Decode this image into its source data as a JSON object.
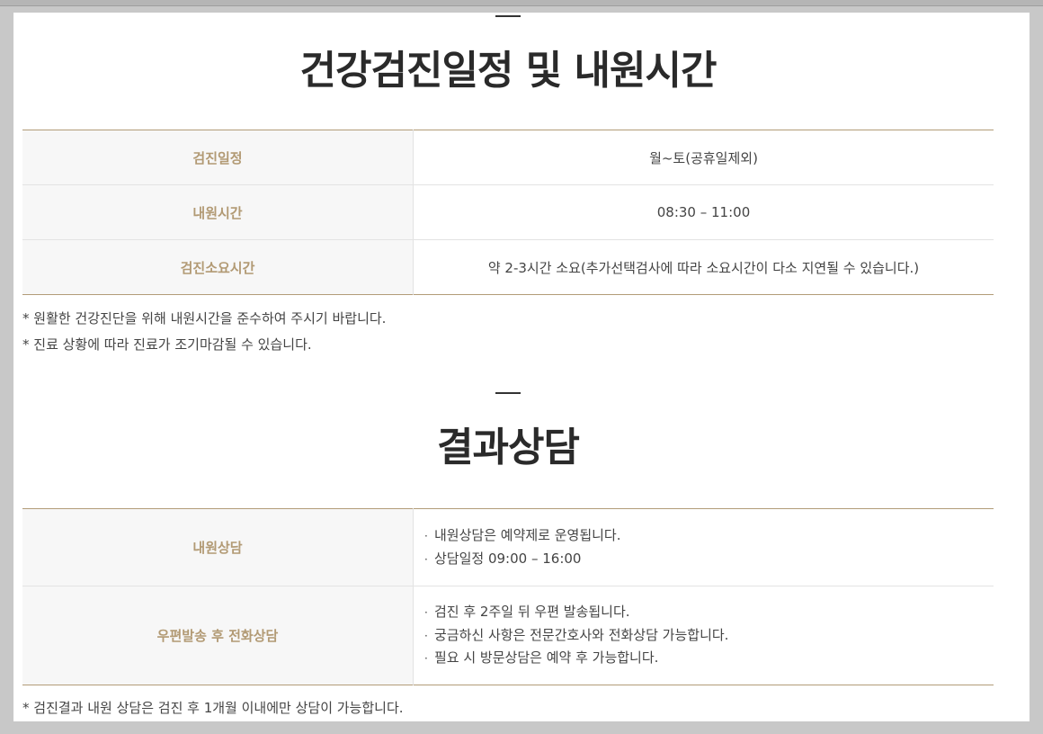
{
  "schedule": {
    "title": "건강검진일정 및 내원시간",
    "rows": [
      {
        "label": "검진일정",
        "value": "월~토(공휴일제외)"
      },
      {
        "label": "내원시간",
        "value": "08:30 – 11:00"
      },
      {
        "label": "검진소요시간",
        "value": "약 2-3시간 소요(추가선택검사에 따라 소요시간이 다소 지연될 수 있습니다.)"
      }
    ],
    "notes": [
      "* 원활한 건강진단을 위해 내원시간을 준수하여 주시기 바랍니다.",
      "* 진료 상황에 따라 진료가 조기마감될 수 있습니다."
    ]
  },
  "consult": {
    "title": "결과상담",
    "rows": [
      {
        "label": "내원상담",
        "items": [
          "내원상담은 예약제로 운영됩니다.",
          "상담일정 09:00 – 16:00"
        ]
      },
      {
        "label": "우편발송 후 전화상담",
        "items": [
          "검진 후 2주일 뒤 우편 발송됩니다.",
          "궁금하신 사항은 전문간호사와 전화상담 가능합니다.",
          "필요 시 방문상담은 예약 후 가능합니다."
        ]
      }
    ],
    "notes": [
      "* 검진결과 내원 상담은 검진 후 1개월 이내에만 상담이 가능합니다."
    ]
  },
  "bullet_glyph": "·"
}
